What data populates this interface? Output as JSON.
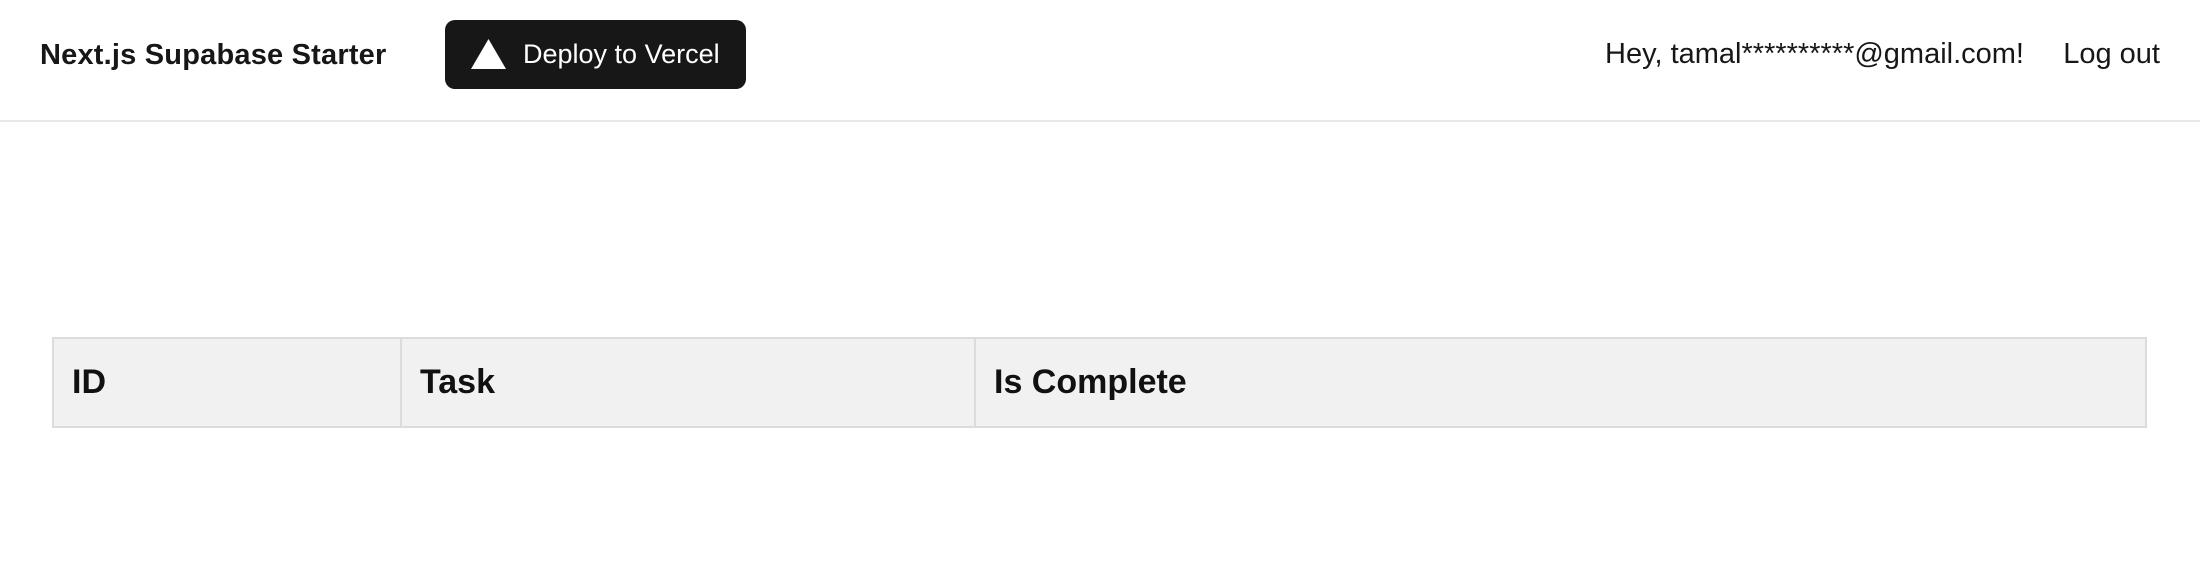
{
  "header": {
    "brand": "Next.js Supabase Starter",
    "deploy_button": {
      "label": "Deploy to Vercel",
      "icon": "vercel-triangle-icon"
    },
    "greeting": "Hey, tamal**********@gmail.com!",
    "logout_label": "Log out"
  },
  "table": {
    "columns": [
      "ID",
      "Task",
      "Is Complete"
    ],
    "rows": []
  },
  "colors": {
    "button_bg": "#171717",
    "header_bg": "#f1f1f1",
    "border": "#dcdcdc"
  }
}
